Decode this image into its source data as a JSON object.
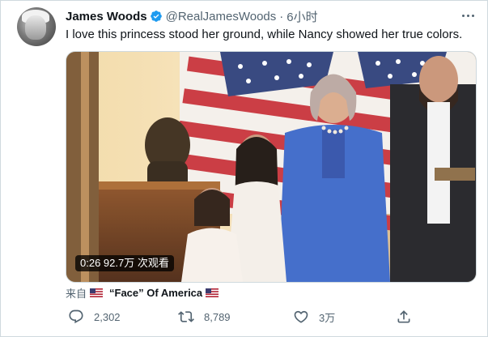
{
  "tweet": {
    "author_name": "James Woods",
    "author_handle": "@RealJamesWoods",
    "separator": "·",
    "time": "6小时",
    "text": "I love this princess stood her ground, while Nancy showed her true colors.",
    "avatar_icon": "avatar-portrait"
  },
  "video": {
    "duration_text": "0:26 92.7万 次观看"
  },
  "source": {
    "prefix": "来自",
    "name": "“Face” Of America",
    "flag_icon": "us-flag-icon"
  },
  "actions": {
    "reply_count": "2,302",
    "retweet_count": "8,789",
    "like_count": "3万"
  },
  "colors": {
    "secondary_text": "#536471",
    "verified_blue": "#1d9bf0",
    "border": "#cfd9de"
  }
}
